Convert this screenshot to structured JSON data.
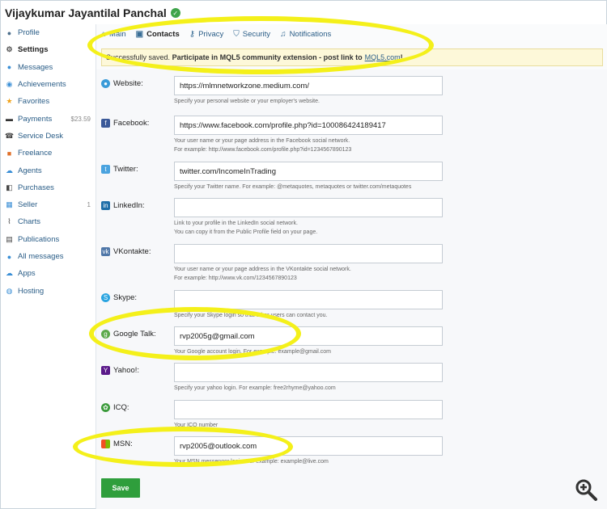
{
  "header": {
    "title": "Vijaykumar Jayantilal Panchal"
  },
  "sidebar": {
    "items": [
      {
        "label": "Profile",
        "icon": "user-icon",
        "extra": ""
      },
      {
        "label": "Settings",
        "icon": "gear-icon",
        "extra": "",
        "active": true
      },
      {
        "label": "Messages",
        "icon": "chat-icon",
        "extra": ""
      },
      {
        "label": "Achievements",
        "icon": "medal-icon",
        "extra": ""
      },
      {
        "label": "Favorites",
        "icon": "star-icon",
        "extra": ""
      },
      {
        "label": "Payments",
        "icon": "card-icon",
        "extra": "$23.59"
      },
      {
        "label": "Service Desk",
        "icon": "phone-icon",
        "extra": ""
      },
      {
        "label": "Freelance",
        "icon": "briefcase-icon",
        "extra": ""
      },
      {
        "label": "Agents",
        "icon": "cloud-icon",
        "extra": ""
      },
      {
        "label": "Purchases",
        "icon": "cart-icon",
        "extra": ""
      },
      {
        "label": "Seller",
        "icon": "grid-icon",
        "extra": "1"
      },
      {
        "label": "Charts",
        "icon": "chart-icon",
        "extra": ""
      },
      {
        "label": "Publications",
        "icon": "book-icon",
        "extra": ""
      },
      {
        "label": "All messages",
        "icon": "messages-icon",
        "extra": ""
      },
      {
        "label": "Apps",
        "icon": "apps-icon",
        "extra": ""
      },
      {
        "label": "Hosting",
        "icon": "globe-icon",
        "extra": ""
      }
    ]
  },
  "tabs": [
    {
      "label": "Main",
      "icon": "home-icon"
    },
    {
      "label": "Contacts",
      "icon": "contact-card-icon",
      "active": true
    },
    {
      "label": "Privacy",
      "icon": "key-icon"
    },
    {
      "label": "Security",
      "icon": "shield-icon"
    },
    {
      "label": "Notifications",
      "icon": "bell-icon"
    }
  ],
  "notice": {
    "text": "Successfully saved.",
    "bold": "Participate in MQL5 community extension - post link to",
    "link": "MQL5.com",
    "tail": "!"
  },
  "fields": [
    {
      "label": "Website:",
      "value": "https://mlmnetworkzone.medium.com/",
      "hint": [
        "Specify your personal website or your employer's website."
      ]
    },
    {
      "label": "Facebook:",
      "value": "https://www.facebook.com/profile.php?id=100086424189417",
      "hint": [
        "Your user name or your page address in the Facebook social network.",
        "For example: http://www.facebook.com/profile.php?id=1234567890123"
      ]
    },
    {
      "label": "Twitter:",
      "value": "twitter.com/IncomeInTrading",
      "hint": [
        "Specify your Twitter name. For example: @metaquotes, metaquotes or twitter.com/metaquotes"
      ]
    },
    {
      "label": "LinkedIn:",
      "value": "",
      "hint": [
        "Link to your profile in the LinkedIn social network.",
        "You can copy it from the Public Profile field on your page."
      ]
    },
    {
      "label": "VKontakte:",
      "value": "",
      "hint": [
        "Your user name or your page address in the VKontakte social network.",
        "For example: http://www.vk.com/1234567890123"
      ]
    },
    {
      "label": "Skype:",
      "value": "",
      "hint": [
        "Specify your Skype login so that other users can contact you."
      ]
    },
    {
      "label": "Google Talk:",
      "value": "rvp2005g@gmail.com",
      "hint": [
        "Your Google account login. For example: example@gmail.com"
      ]
    },
    {
      "label": "Yahoo!:",
      "value": "",
      "hint": [
        "Specify your yahoo login. For example: free2rhyme@yahoo.com"
      ]
    },
    {
      "label": "ICQ:",
      "value": "",
      "hint": [
        "Your ICQ number"
      ]
    },
    {
      "label": "MSN:",
      "value": "rvp2005@outlook.com",
      "hint": [
        "Your MSN messenger login. For example: example@live.com"
      ]
    }
  ],
  "save_label": "Save",
  "colors": {
    "accent": "#2a5d87",
    "save": "#2f9e3c",
    "highlight": "#f4f01a",
    "notice_bg": "#fdf8d9"
  }
}
